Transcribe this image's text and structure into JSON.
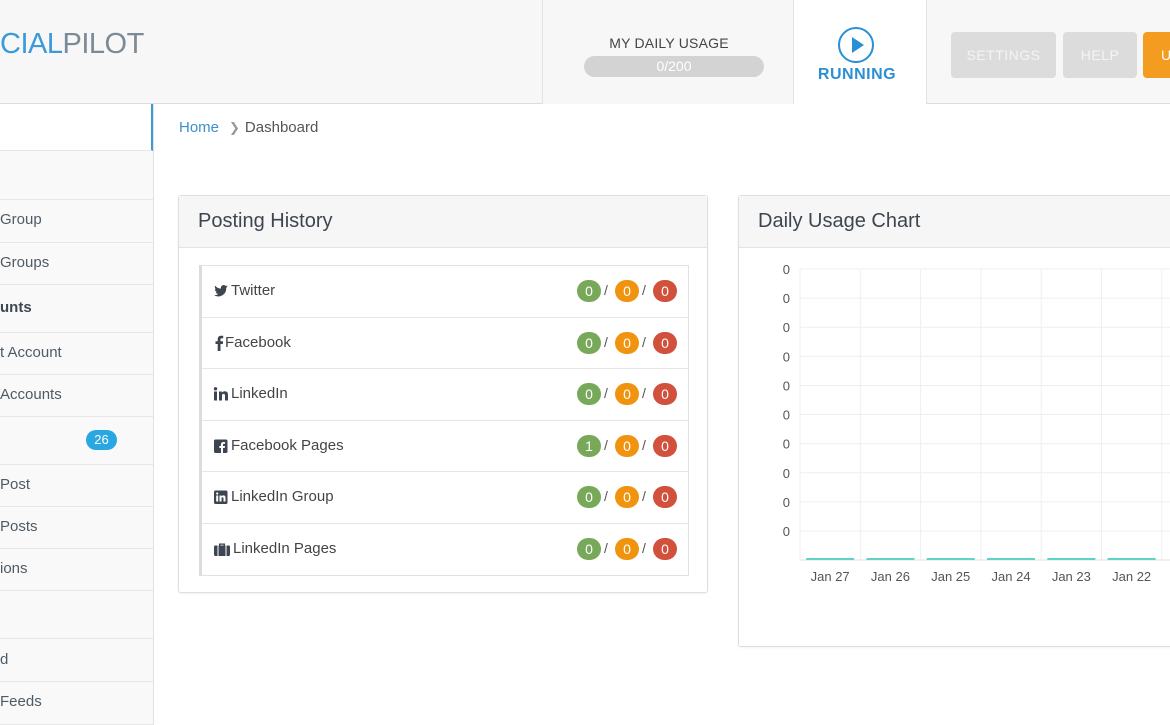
{
  "header": {
    "logo_part1": "CIAL",
    "logo_part2": "PILOT",
    "usage_title": "MY DAILY USAGE",
    "usage_value": "0/200",
    "usage_progress": 0,
    "status": "RUNNING",
    "buttons": {
      "settings": "SETTINGS",
      "help": "HELP",
      "upgrade": "U"
    },
    "colors": {
      "accent": "#2c8fd6",
      "upgrade": "#f49c1f"
    }
  },
  "sidebar": {
    "items": [
      {
        "label": "Group"
      },
      {
        "label": " Groups"
      },
      {
        "label": "unts"
      },
      {
        "label": "t Account"
      },
      {
        "label": " Accounts"
      },
      {
        "label": "",
        "badge": "26"
      },
      {
        "label": "Post"
      },
      {
        "label": " Posts"
      },
      {
        "label": "ions"
      },
      {
        "label": "d"
      },
      {
        "label": " Feeds"
      }
    ]
  },
  "breadcrumb": {
    "home": "Home",
    "current": "Dashboard"
  },
  "posting_history": {
    "title": "Posting History",
    "rows": [
      {
        "label": "Twitter",
        "icon": "twitter-icon",
        "a": "0",
        "b": "0",
        "c": "0"
      },
      {
        "label": "Facebook",
        "icon": "facebook-icon",
        "a": "0",
        "b": "0",
        "c": "0"
      },
      {
        "label": "LinkedIn",
        "icon": "linkedin-icon",
        "a": "0",
        "b": "0",
        "c": "0"
      },
      {
        "label": "Facebook Pages",
        "icon": "facebook-square-icon",
        "a": "1",
        "b": "0",
        "c": "0"
      },
      {
        "label": "LinkedIn Group",
        "icon": "linkedin-square-icon",
        "a": "0",
        "b": "0",
        "c": "0"
      },
      {
        "label": "LinkedIn Pages",
        "icon": "briefcase-icon",
        "a": "0",
        "b": "0",
        "c": "0"
      }
    ],
    "separator": "/"
  },
  "chart_data": {
    "type": "bar",
    "title": "Daily Usage Chart",
    "categories": [
      "Jan 27",
      "Jan 26",
      "Jan 25",
      "Jan 24",
      "Jan 23",
      "Jan 22"
    ],
    "values": [
      0,
      0,
      0,
      0,
      0,
      0
    ],
    "y_tick_labels": [
      "0",
      "0",
      "0",
      "0",
      "0",
      "0",
      "0",
      "0",
      "0",
      "0"
    ],
    "grid": true,
    "bar_color": "#5fd3c5"
  }
}
